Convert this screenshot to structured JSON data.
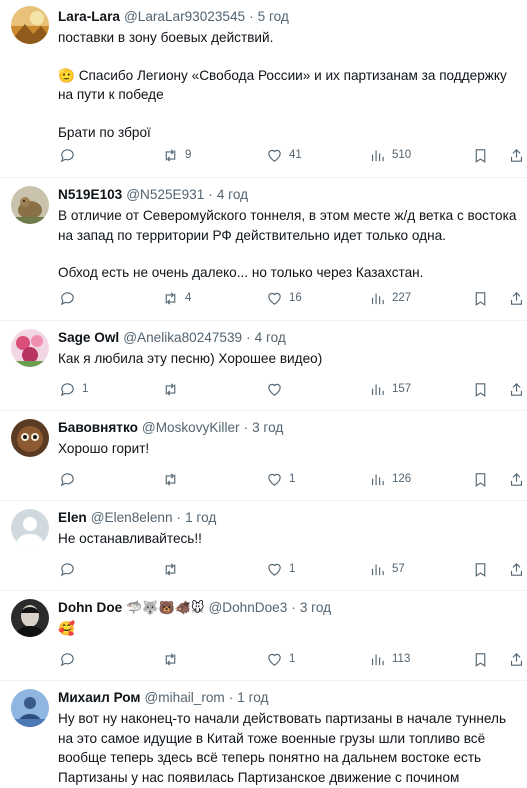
{
  "tweets": [
    {
      "name": "Lara-Lara",
      "handle": "@LaraLar93023545",
      "time": "5 год",
      "lines": [
        "поставки в зону боевых действий.",
        "",
        "🫡  Спасибо Легиону «Свобода России» и их партизанам за поддержку",
        "на пути к победе",
        "",
        "Брати по зброї"
      ],
      "replies": "",
      "retweets": "9",
      "likes": "41",
      "views": "510"
    },
    {
      "name": "N519E103",
      "handle": "@N525E931",
      "time": "4 год",
      "lines": [
        "В отличие от Северомуйского тоннеля, в этом месте ж/д ветка с востока",
        "на запад по территории РФ действительно идет только одна.",
        "",
        "Обход есть не очень далеко... но только через Казахстан."
      ],
      "replies": "",
      "retweets": "4",
      "likes": "16",
      "views": "227"
    },
    {
      "name": "Sage Owl",
      "handle": "@Anelika80247539",
      "time": "4 год",
      "lines": [
        "Как я любила эту песню) Хорошее видео)"
      ],
      "replies": "1",
      "retweets": "",
      "likes": "",
      "views": "157"
    },
    {
      "name": "Бавовнятко",
      "handle": "@MoskovyKiller",
      "time": "3 год",
      "lines": [
        "Хорошо горит!"
      ],
      "replies": "",
      "retweets": "",
      "likes": "1",
      "views": "126"
    },
    {
      "name": "Elen",
      "handle": "@Elen8elenn",
      "time": "1 год",
      "lines": [
        "Не останавливайтесь!!"
      ],
      "replies": "",
      "retweets": "",
      "likes": "1",
      "views": "57"
    },
    {
      "name": "Dohn Doe",
      "name_emojis": "🦈🐺🐻🐗🐭",
      "handle": "@DohnDoe3",
      "time": "3 год",
      "lines": [
        "🥰"
      ],
      "replies": "",
      "retweets": "",
      "likes": "1",
      "views": "113"
    },
    {
      "name": "Михаил Ром",
      "handle": "@mihail_rom",
      "time": "1 год",
      "lines": [
        "Ну вот ну наконец-то начали действовать партизаны в начале туннель",
        "на это самое идущие в Китай тоже военные грузы шли топливо всё",
        "вообще теперь здесь всё теперь понятно на дальнем востоке есть",
        "Партизаны у нас появилась Партизанское движение с почином"
      ]
    }
  ],
  "separator": "·",
  "colors": {
    "text": "#0f1419",
    "muted": "#536471",
    "divider": "#eff3f4"
  }
}
